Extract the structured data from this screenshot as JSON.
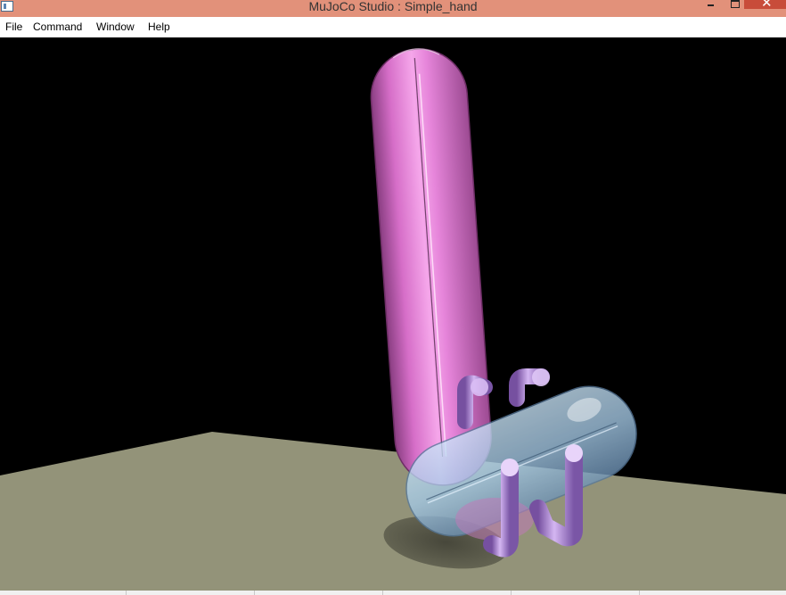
{
  "window": {
    "title": "MuJoCo Studio : Simple_hand",
    "titlebar_color": "#e2917a",
    "close_color": "#c84c3a",
    "icons": [
      "app-icon",
      "minimize-icon",
      "maximize-icon",
      "close-icon"
    ]
  },
  "window_controls": {
    "close_glyph": "✕"
  },
  "menu": {
    "items": [
      {
        "label": "File"
      },
      {
        "label": "Command"
      },
      {
        "label": "Window"
      },
      {
        "label": "Help"
      }
    ]
  },
  "scene": {
    "background": "#000000",
    "floor_color": "#939379",
    "upright_capsule_color": "#e07ad0",
    "body_capsule_color": "#9ec8e8",
    "finger_color": "#b48ad8"
  },
  "statusbar": {
    "sections": 6
  }
}
